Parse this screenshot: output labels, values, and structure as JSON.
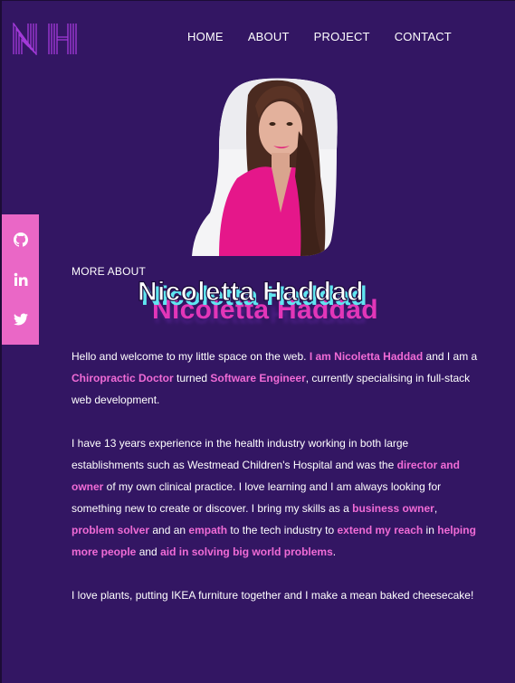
{
  "logo": {
    "text": "NH"
  },
  "nav": {
    "items": [
      "HOME",
      "ABOUT",
      "PROJECT",
      "CONTACT"
    ]
  },
  "social": {
    "icons": [
      "github-icon",
      "linkedin-icon",
      "twitter-icon"
    ],
    "color": "#ea67c6"
  },
  "section": {
    "subtitle": "MORE ABOUT",
    "name": "Nicoletta Haddad"
  },
  "paragraphs": {
    "p1": [
      {
        "t": "Hello and welcome to my little space on the web. ",
        "h": false
      },
      {
        "t": "I am Nicoletta Haddad",
        "h": true
      },
      {
        "t": " and I am a ",
        "h": false
      },
      {
        "t": "Chiropractic Doctor",
        "h": true
      },
      {
        "t": " turned ",
        "h": false
      },
      {
        "t": "Software Engineer",
        "h": true
      },
      {
        "t": ", currently specialising in full-stack web development.",
        "h": false
      }
    ],
    "p2": [
      {
        "t": "I have 13 years experience in the health industry working in both large establishments such as Westmead Children's Hospital and was the ",
        "h": false
      },
      {
        "t": "director and owner",
        "h": true
      },
      {
        "t": " of my own clinical practice. I love learning and I am always looking for something new to create or discover. I bring my skills as a ",
        "h": false
      },
      {
        "t": "business owner",
        "h": true
      },
      {
        "t": ", ",
        "h": false
      },
      {
        "t": "problem solver",
        "h": true
      },
      {
        "t": " and an ",
        "h": false
      },
      {
        "t": "empath",
        "h": true
      },
      {
        "t": " to the tech industry to ",
        "h": false
      },
      {
        "t": "extend my reach",
        "h": true
      },
      {
        "t": " in ",
        "h": false
      },
      {
        "t": "helping more people",
        "h": true
      },
      {
        "t": " and ",
        "h": false
      },
      {
        "t": "aid in solving big world problems",
        "h": true
      },
      {
        "t": ".",
        "h": false
      }
    ],
    "p3": [
      {
        "t": "I love plants, putting IKEA furniture together and I make a mean baked cheesecake!",
        "h": false
      }
    ]
  },
  "colors": {
    "background": "#331663",
    "accent": "#f06bd6"
  }
}
